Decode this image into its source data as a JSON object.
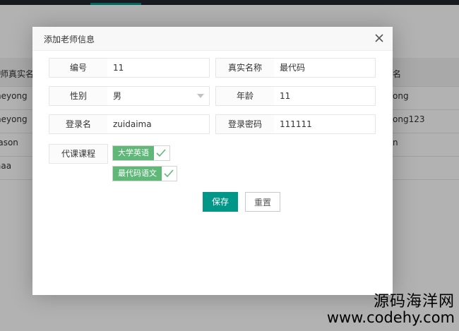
{
  "background": {
    "header_label": "教师真实名",
    "header_label_right": "名",
    "rows": [
      {
        "left": "heyong",
        "right": "ong"
      },
      {
        "left": "heyong",
        "right": "ong123"
      },
      {
        "left": "jason",
        "right": "n"
      },
      {
        "left": "aaa",
        "right": ""
      }
    ]
  },
  "modal": {
    "title": "添加老师信息",
    "close_icon": "close-icon",
    "fields": {
      "number": {
        "label": "编号",
        "value": "11"
      },
      "real_name": {
        "label": "真实名称",
        "value": "最代码"
      },
      "gender": {
        "label": "性别",
        "value": "男"
      },
      "age": {
        "label": "年龄",
        "value": "11"
      },
      "login_name": {
        "label": "登录名",
        "value": "zuidaima"
      },
      "login_password": {
        "label": "登录密码",
        "value": "111111"
      }
    },
    "courses_label": "代课课程",
    "courses": [
      {
        "name": "大学英语",
        "checked": true
      },
      {
        "name": "最代码语文",
        "checked": true
      }
    ],
    "buttons": {
      "save": "保存",
      "reset": "重置"
    }
  },
  "colors": {
    "primary": "#009688",
    "tag_green": "#5fb878"
  },
  "watermark": {
    "line1": "源码海洋网",
    "line2": "www.codehy.com"
  }
}
